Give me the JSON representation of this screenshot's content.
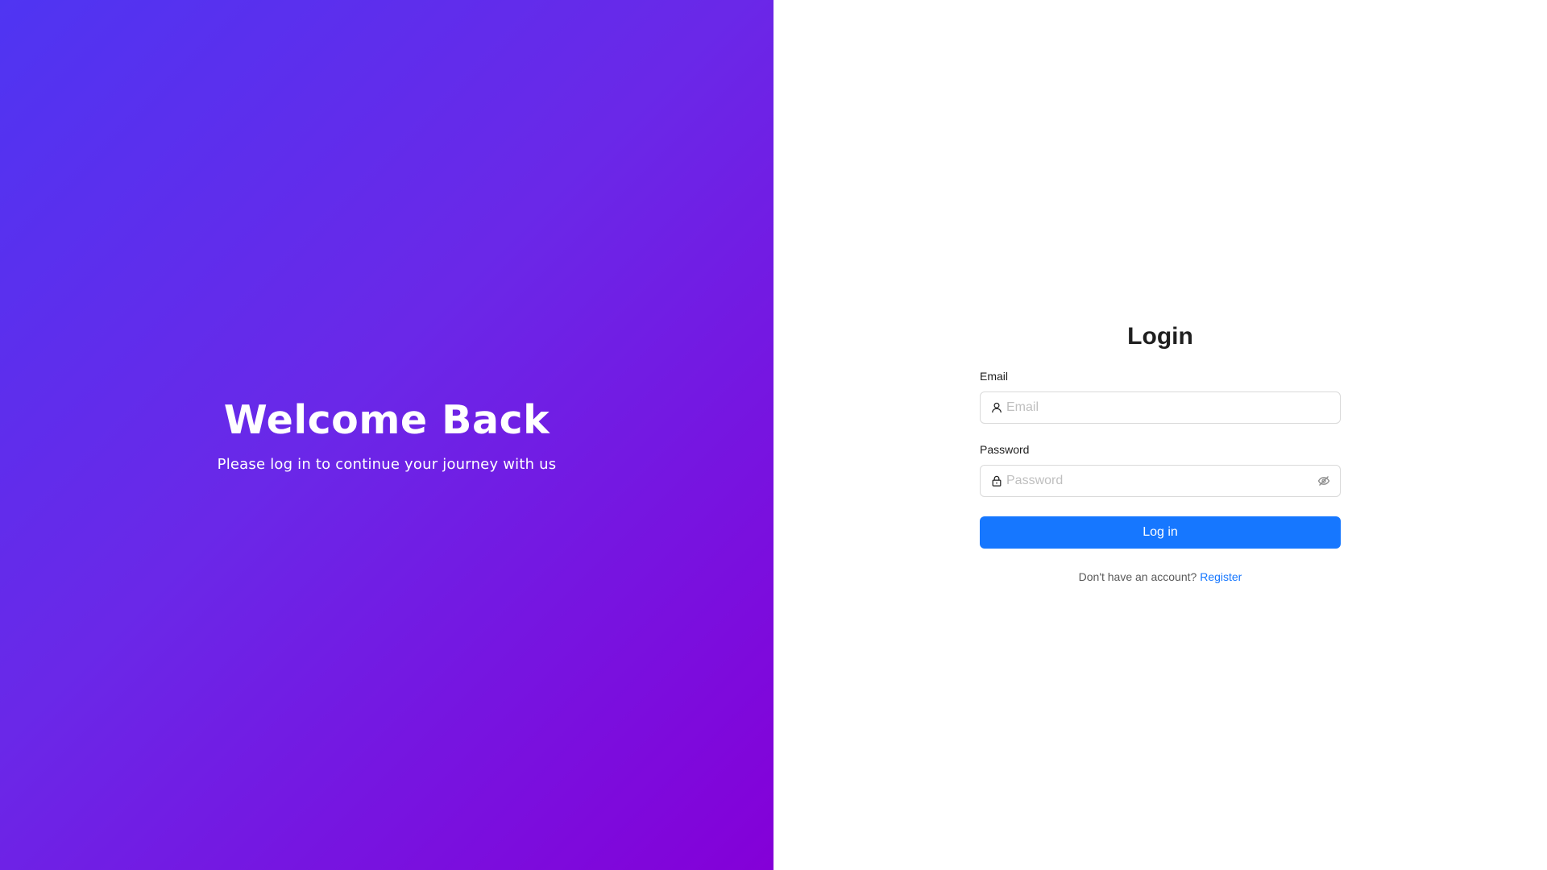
{
  "hero": {
    "title": "Welcome Back",
    "subtitle": "Please log in to continue your journey with us"
  },
  "login": {
    "title": "Login",
    "email": {
      "label": "Email",
      "placeholder": "Email",
      "value": ""
    },
    "password": {
      "label": "Password",
      "placeholder": "Password",
      "value": ""
    },
    "submit_label": "Log in",
    "no_account_text": "Don't have an account?",
    "register_label": "Register"
  },
  "icons": {
    "email_prefix": "user-icon",
    "password_prefix": "lock-icon",
    "password_toggle": "eye-invisible-icon"
  },
  "colors": {
    "hero_gradient_start": "#4f35f2",
    "hero_gradient_end": "#8400d8",
    "primary": "#1677ff",
    "text": "#1f1f1f",
    "placeholder": "#bfbfbf",
    "border": "#d9d9d9"
  }
}
